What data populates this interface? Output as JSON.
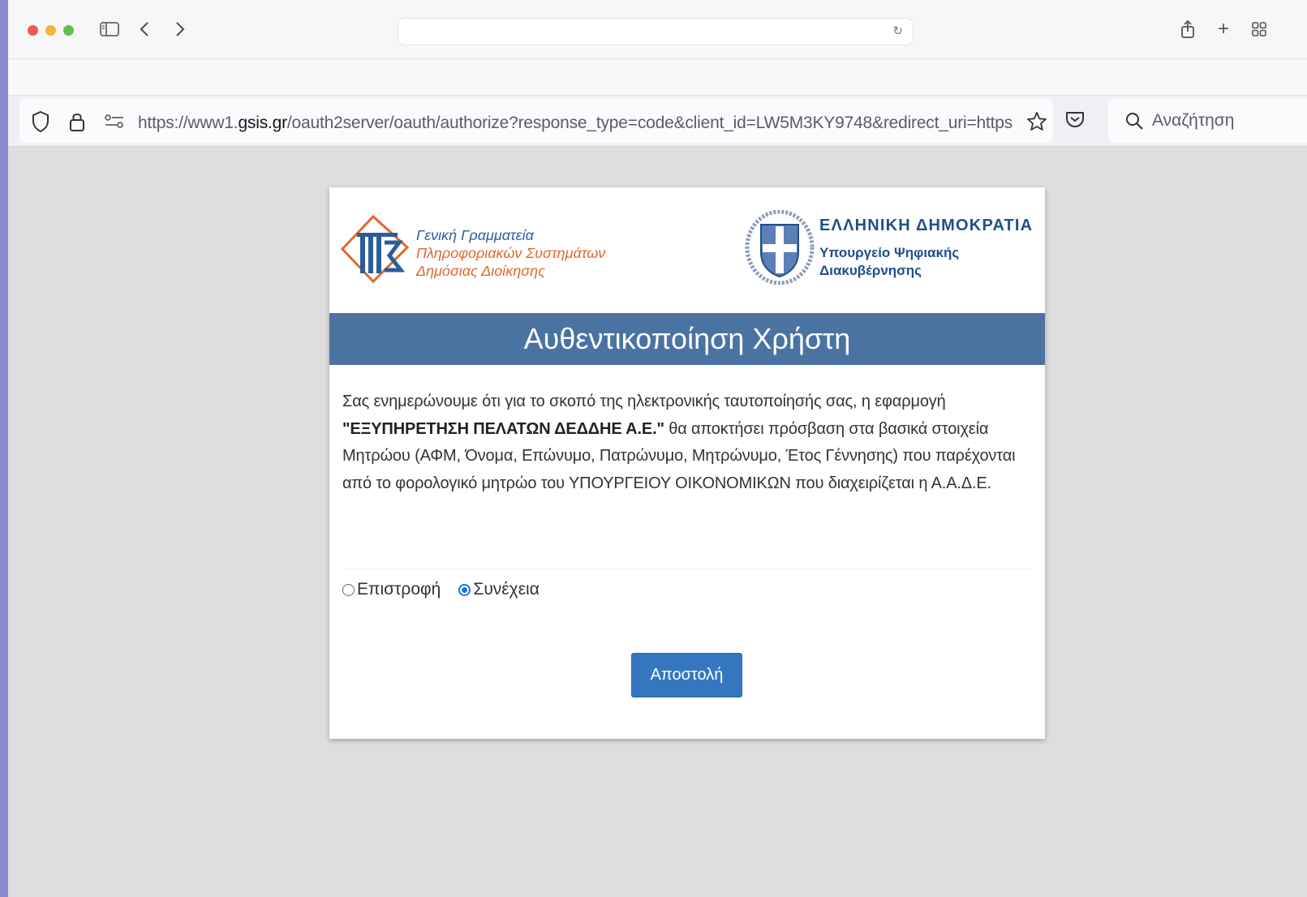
{
  "browser": {
    "url_prefix": "https://www1.",
    "url_domain": "gsis.gr",
    "url_path": "/oauth2server/oauth/authorize?response_type=code&client_id=LW5M3KY9748&redirect_uri=https",
    "search_placeholder": "Αναζήτηση",
    "top_field_value": ""
  },
  "header": {
    "gsis_lines": [
      "Γενική Γραμματεία",
      "Πληροφοριακών Συστημάτων",
      "Δημόσιας Διοίκησης"
    ],
    "republic_title": "ΕΛΛΗΝΙΚΗ ΔΗΜΟΚΡΑΤΙΑ",
    "ministry_line1": "Υπουργείο Ψηφιακής",
    "ministry_line2": "Διακυβέρνησης"
  },
  "banner_title": "Αυθεντικοποίηση Χρήστη",
  "info": {
    "part1": "Σας ενημερώνουμε ότι για το σκοπό της ηλεκτρονικής ταυτοποίησής σας, η εφαρμογή ",
    "app_name": "\"ΕΞΥΠΗΡΕΤΗΣΗ ΠΕΛΑΤΩΝ ΔΕΔΔΗΕ Α.Ε.\"",
    "part2": " θα αποκτήσει πρόσβαση στα βασικά στοιχεία Μητρώου (ΑΦΜ, Όνομα, Επώνυμο, Πατρώνυμο, Μητρώνυμο, Έτος Γέννησης) που παρέχονται από το φορολογικό μητρώο του ΥΠΟΥΡΓΕΙΟΥ ΟΙΚΟΝΟΜΙΚΩΝ που διαχειρίζεται η Α.Α.Δ.Ε."
  },
  "options": {
    "back_label": "Επιστροφή",
    "continue_label": "Συνέχεια",
    "selected": "continue"
  },
  "submit_label": "Αποστολή",
  "colors": {
    "banner": "#4a73a1",
    "button": "#3477c0",
    "gsis_blue": "#2a5d9c",
    "gsis_orange": "#e0672c",
    "republic_blue": "#214f8c"
  }
}
